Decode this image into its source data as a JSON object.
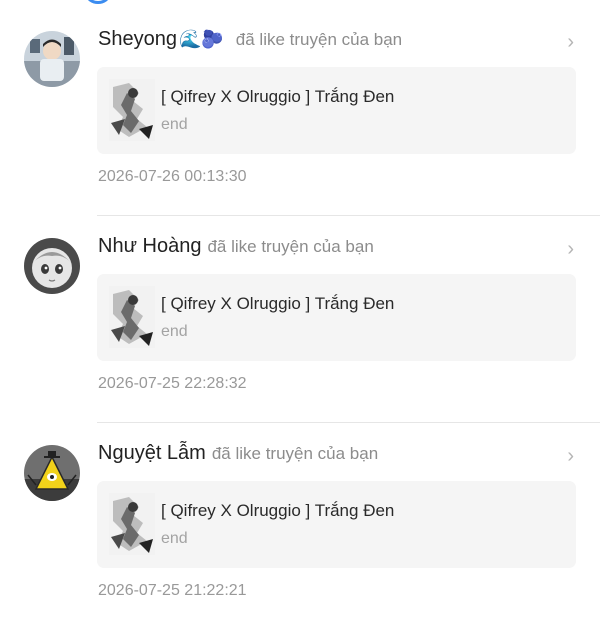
{
  "notifications": [
    {
      "username": "Sheyong",
      "emoji": "🌊🫐",
      "action": "đã like truyện của bạn",
      "story_title": "[ Qifrey X Olruggio ] Trắng Đen",
      "story_sub": "end",
      "time": "2026-07-26 00:13:30"
    },
    {
      "username": "Như Hoàng",
      "emoji": "",
      "action": "đã like truyện của bạn",
      "story_title": "[ Qifrey X Olruggio ] Trắng Đen",
      "story_sub": "end",
      "time": "2026-07-25 22:28:32"
    },
    {
      "username": "Nguyệt Lẫm",
      "emoji": "",
      "action": "đã like truyện của bạn",
      "story_title": "[ Qifrey X Olruggio ] Trắng Đen",
      "story_sub": "end",
      "time": "2026-07-25 21:22:21"
    }
  ],
  "colors": {
    "accent": "#3b8cf0",
    "card_bg": "#f5f5f5",
    "muted_text": "#8c8c8c",
    "divider": "#e6e6e6"
  },
  "icons": {
    "chevron": "chevron-right-icon"
  }
}
